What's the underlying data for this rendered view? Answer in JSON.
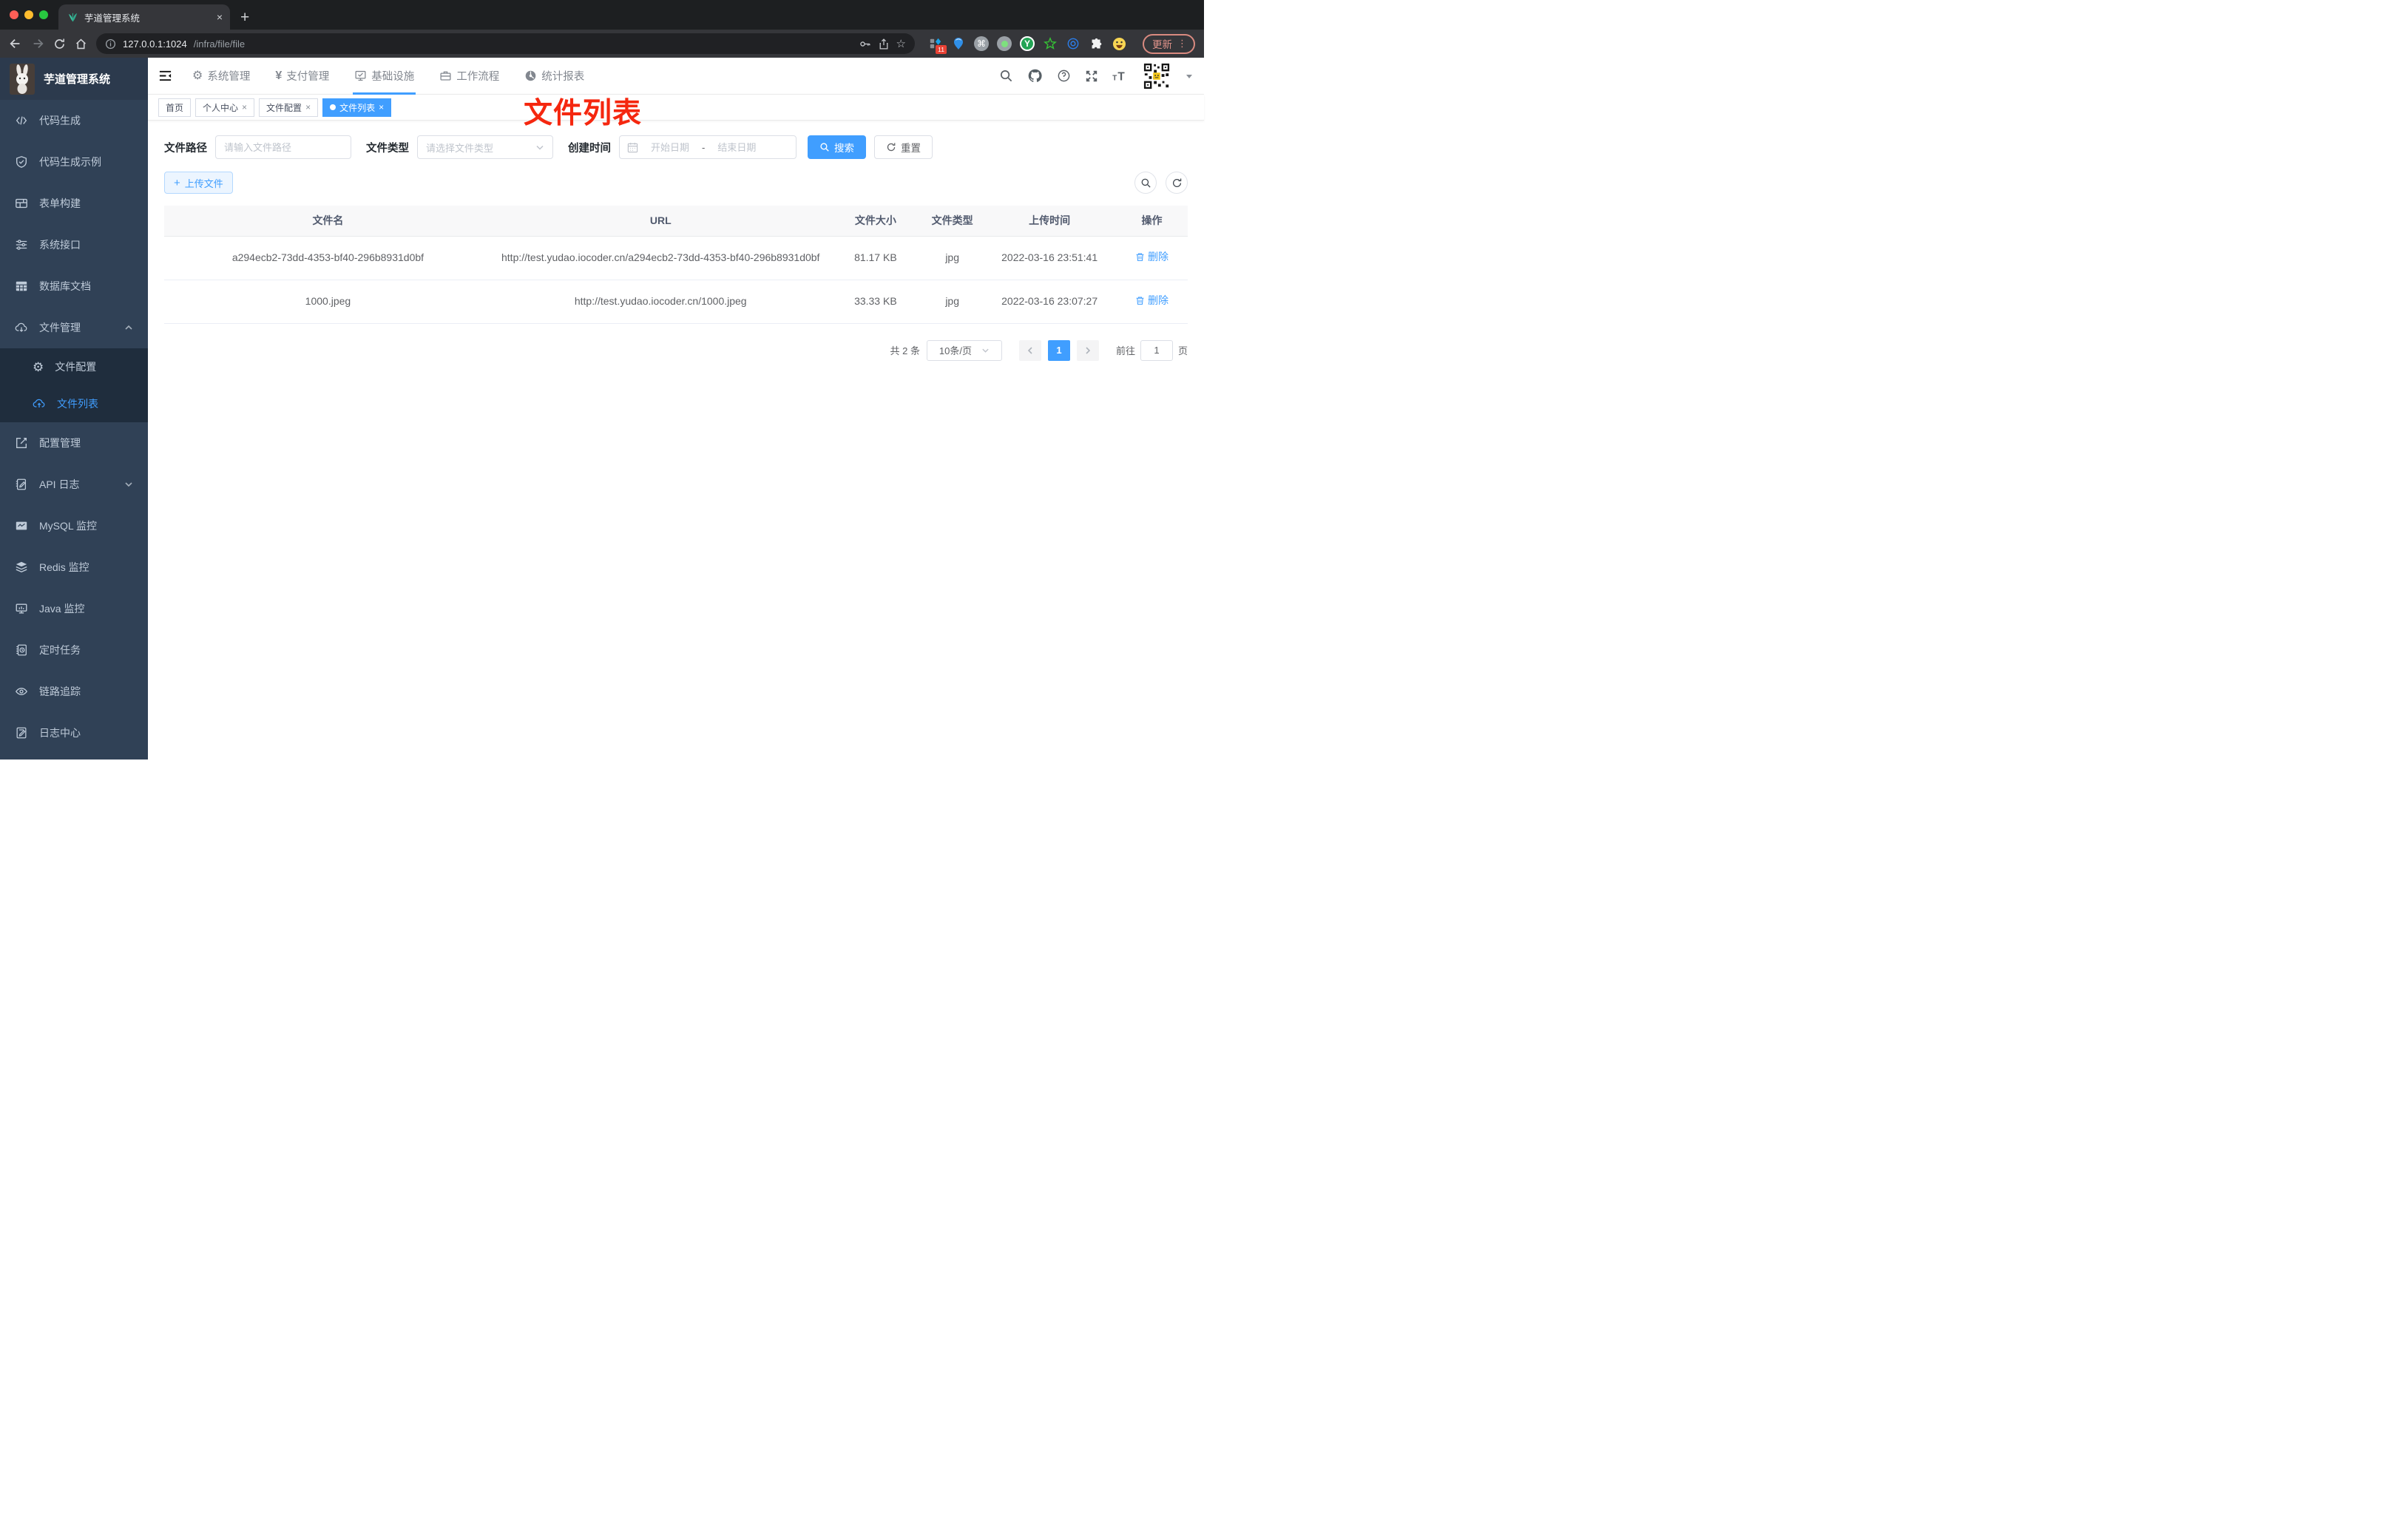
{
  "icons": {
    "close": "×",
    "plus": "+",
    "kebab": "⋮",
    "dash": "-",
    "yen": "¥",
    "gear": "⚙",
    "star": "☆",
    "cmd": "⌘",
    "y": "Y"
  },
  "browser": {
    "tab_title": "芋道管理系统",
    "url_host": "127.0.0.1:1024",
    "url_path": "/infra/file/file",
    "ext_badge": "11",
    "update_label": "更新"
  },
  "header": {
    "nav": [
      {
        "label": "系统管理"
      },
      {
        "label": "支付管理"
      },
      {
        "label": "基础设施"
      },
      {
        "label": "工作流程"
      },
      {
        "label": "统计报表"
      }
    ]
  },
  "tags": [
    {
      "label": "首页"
    },
    {
      "label": "个人中心"
    },
    {
      "label": "文件配置"
    },
    {
      "label": "文件列表"
    }
  ],
  "annotation": "文件列表",
  "sidebar": {
    "title": "芋道管理系统",
    "items_top": [
      "代码生成",
      "代码生成示例",
      "表单构建",
      "系统接口",
      "数据库文档"
    ],
    "group_label": "文件管理",
    "children": [
      "文件配置",
      "文件列表"
    ],
    "items_bottom": [
      "配置管理",
      "API 日志",
      "MySQL 监控",
      "Redis 监控",
      "Java 监控",
      "定时任务",
      "链路追踪",
      "日志中心"
    ]
  },
  "filters": {
    "path_label": "文件路径",
    "path_placeholder": "请输入文件路径",
    "type_label": "文件类型",
    "type_placeholder": "请选择文件类型",
    "date_label": "创建时间",
    "date_start": "开始日期",
    "date_end": "结束日期",
    "search_label": "搜索",
    "reset_label": "重置"
  },
  "toolbar": {
    "upload_label": "上传文件"
  },
  "table": {
    "columns": [
      "文件名",
      "URL",
      "文件大小",
      "文件类型",
      "上传时间",
      "操作"
    ],
    "rows": [
      {
        "name": "a294ecb2-73dd-4353-bf40-296b8931d0bf",
        "url": "http://test.yudao.iocoder.cn/a294ecb2-73dd-4353-bf40-296b8931d0bf",
        "size": "81.17 KB",
        "type": "jpg",
        "time": "2022-03-16 23:51:41",
        "action": "删除"
      },
      {
        "name": "1000.jpeg",
        "url": "http://test.yudao.iocoder.cn/1000.jpeg",
        "size": "33.33 KB",
        "type": "jpg",
        "time": "2022-03-16 23:07:27",
        "action": "删除"
      }
    ]
  },
  "pagination": {
    "total": "共 2 条",
    "page_size": "10条/页",
    "current_page": "1",
    "goto_label": "前往",
    "goto_value": "1",
    "page_unit": "页"
  },
  "colors": {
    "accent": "#409eff",
    "annotation_red": "#f5270f",
    "sidebar_bg": "#304156",
    "submenu_bg": "#1f2d3d",
    "chrome_bg": "#35363a",
    "table_header_bg": "#f8f8f9"
  }
}
